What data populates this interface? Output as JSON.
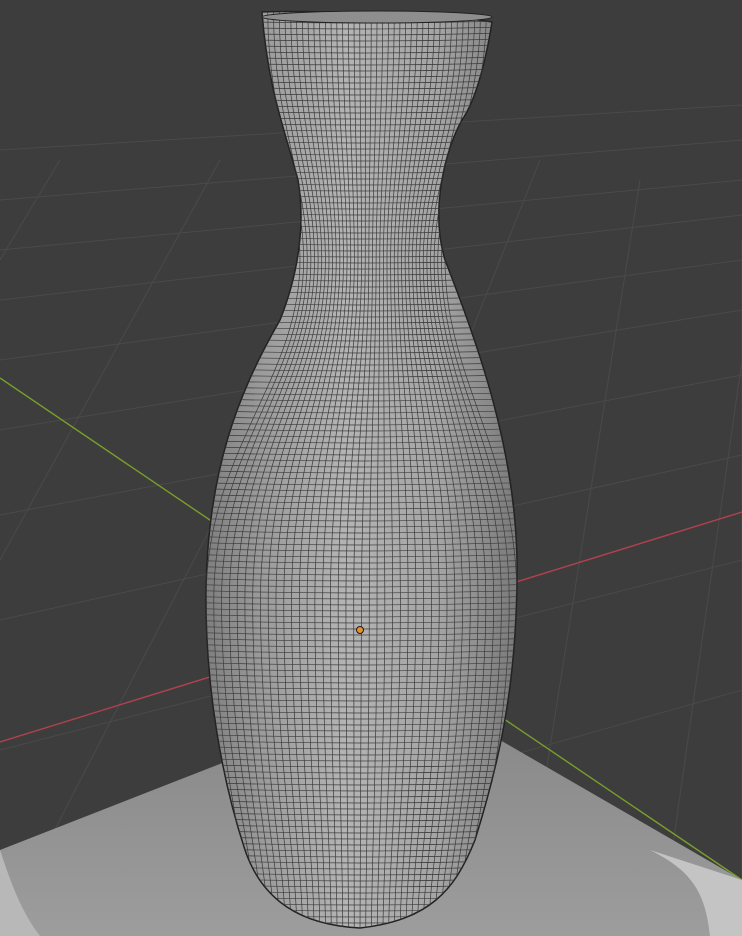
{
  "viewport": {
    "background": "#3d3d3d",
    "grid_color": "#4a4a4a",
    "x_axis_color": "#b34150",
    "y_axis_color": "#7a9e2a"
  },
  "scene": {
    "objects": [
      {
        "name": "vase",
        "type": "mesh",
        "wireframe": true,
        "selected": false,
        "color": "#a9a9a9"
      },
      {
        "name": "pedestal",
        "type": "mesh",
        "wireframe": false,
        "color": "#9a9a9a"
      }
    ],
    "origin_marker_color": "#e8912a"
  }
}
